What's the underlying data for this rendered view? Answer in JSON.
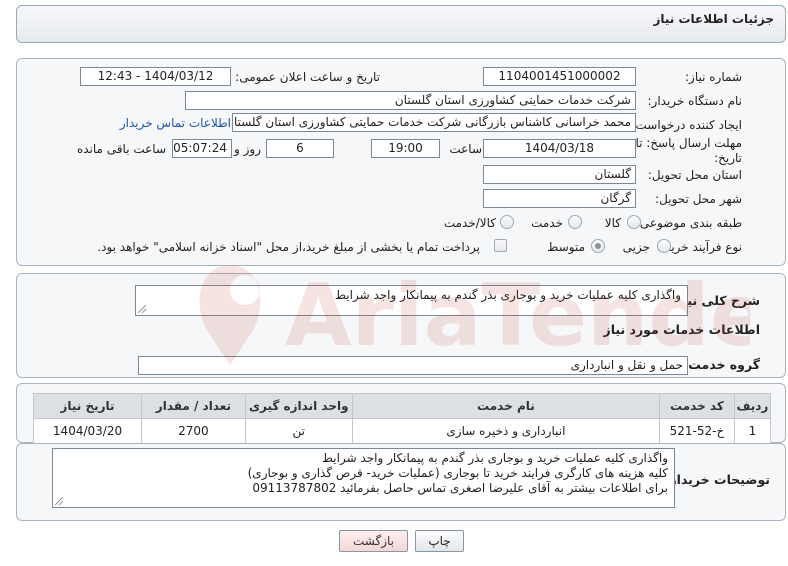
{
  "header": {
    "title": "جزئیات اطلاعات نیاز"
  },
  "form": {
    "need_number_label": "شماره نیاز:",
    "need_number": "1104001451000002",
    "announce_label": "تاریخ و ساعت اعلان عمومی:",
    "announce_value": "1404/03/12 - 12:43",
    "buyer_org_label": "نام دستگاه خریدار:",
    "buyer_org": "شرکت خدمات حمایتی کشاورزی استان گلستان",
    "creator_label": "ایجاد کننده درخواست:",
    "creator": "محمد خراسانی کاشناس بازرگانی شرکت خدمات حمایتی کشاورزی استان گلستان",
    "contact_link": "اطلاعات تماس خریدار",
    "deadline_label_1": "مهلت ارسال پاسخ: تا",
    "deadline_label_2": "تاریخ:",
    "deadline_date": "1404/03/18",
    "time_label": "ساعت",
    "deadline_time": "19:00",
    "days_value": "6",
    "days_label": "روز و",
    "remaining_time": "05:07:24",
    "remaining_label": "ساعت باقی مانده",
    "province_label": "استان محل تحویل:",
    "province": "گلستان",
    "city_label": "شهر محل تحویل:",
    "city": "گرگان",
    "category_label": "طبقه بندی موضوعی:",
    "category_options": [
      "کالا",
      "خدمت",
      "کالا/خدمت"
    ],
    "process_label": "نوع فرآیند خرید :",
    "process_options": [
      "جزیی",
      "متوسط"
    ],
    "treasury_note": "پرداخت تمام یا بخشی از مبلغ خرید،از محل \"اسناد خزانه اسلامی\" خواهد بود."
  },
  "description": {
    "label": "شرح کلی نیاز:",
    "value": "واگذاری کلیه عملیات خرید و بوجاری بذر گندم به پیمانکار واجد شرایط"
  },
  "services": {
    "section_title": "اطلاعات خدمات مورد نیاز",
    "group_label": "گروه خدمت:",
    "group_value": "حمل و نقل و انبارداری",
    "columns": [
      "ردیف",
      "کد خدمت",
      "نام خدمت",
      "واحد اندازه گیری",
      "تعداد / مقدار",
      "تاریخ نیاز"
    ],
    "rows": [
      [
        "1",
        "خ-52-521",
        "انبارداری و ذخیره سازی",
        "تن",
        "2700",
        "1404/03/20"
      ]
    ]
  },
  "buyer_notes": {
    "label": "توضیحات خریدار:",
    "line1": "واگذاری کلیه عملیات خرید و بوجاری بذر گندم به پیمانکار واجد شرایط",
    "line2": "کلیه هزینه های کارگری فرایند خرید تا بوجاری (عملیات خرید- قرص گذاری و بوجاری)",
    "line3": "برای اطلاعات بیشتر به آقای علیرضا اصغری تماس حاصل بفرمائید 09113787802"
  },
  "buttons": {
    "print": "چاپ",
    "back": "بازگشت"
  },
  "watermark": {
    "text": "AriaTender.net"
  },
  "colors": {
    "link": "#2255aa",
    "header_bg": "#e6e9ee",
    "panel_border": "#a9b4c2"
  }
}
